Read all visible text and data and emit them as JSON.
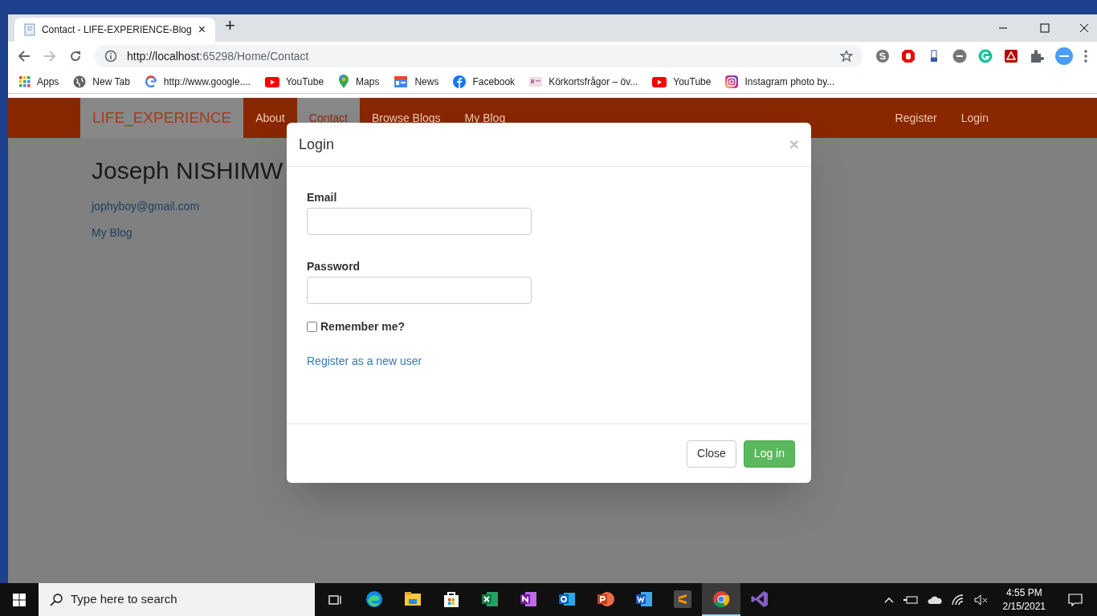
{
  "browser": {
    "tab_title": "Contact - LIFE-EXPERIENCE-Blog",
    "tab_close": "×",
    "new_tab": "+",
    "url_host": "http://localhost",
    "url_rest": ":65298/Home/Contact",
    "bookmarks": [
      {
        "label": "Apps",
        "kind": "apps"
      },
      {
        "label": "New Tab",
        "kind": "globe"
      },
      {
        "label": "http://www.google....",
        "kind": "google"
      },
      {
        "label": "YouTube",
        "kind": "youtube"
      },
      {
        "label": "Maps",
        "kind": "maps"
      },
      {
        "label": "News",
        "kind": "news"
      },
      {
        "label": "Facebook",
        "kind": "facebook"
      },
      {
        "label": "Körkortsfrågor – öv...",
        "kind": "card"
      },
      {
        "label": "YouTube",
        "kind": "youtube"
      },
      {
        "label": "Instagram photo by...",
        "kind": "instagram"
      }
    ]
  },
  "site": {
    "brand": "LIFE_EXPERIENCE",
    "nav": [
      {
        "label": "About",
        "selected": false
      },
      {
        "label": "Contact",
        "selected": true
      },
      {
        "label": "Browse Blogs",
        "selected": false
      },
      {
        "label": "My Blog",
        "selected": false
      }
    ],
    "nav_right": [
      "Register",
      "Login"
    ],
    "name": "Joseph NISHIMW",
    "email": "jophyboy@gmail.com",
    "blog_link": "My Blog"
  },
  "modal": {
    "title": "Login",
    "close": "×",
    "fields": [
      {
        "label": "Email"
      },
      {
        "label": "Password"
      }
    ],
    "remember": {
      "label": "Remember me?",
      "checked": false
    },
    "register_link": "Register as a new user",
    "buttons": [
      {
        "label": "Close",
        "kind": "default"
      },
      {
        "label": "Log in",
        "kind": "success"
      }
    ]
  },
  "taskbar": {
    "search_placeholder": "Type here to search",
    "time": "4:55 PM",
    "date": "2/15/2021",
    "apps": [
      {
        "kind": "edge",
        "selected": false
      },
      {
        "kind": "explorer",
        "selected": false
      },
      {
        "kind": "store",
        "selected": false
      },
      {
        "kind": "excel",
        "selected": false
      },
      {
        "kind": "onenote",
        "selected": false
      },
      {
        "kind": "outlook",
        "selected": false
      },
      {
        "kind": "powerpoint",
        "selected": false
      },
      {
        "kind": "word",
        "selected": false
      },
      {
        "kind": "sublime",
        "selected": false
      },
      {
        "kind": "chrome",
        "selected": true
      },
      {
        "kind": "vs",
        "selected": false
      }
    ]
  }
}
